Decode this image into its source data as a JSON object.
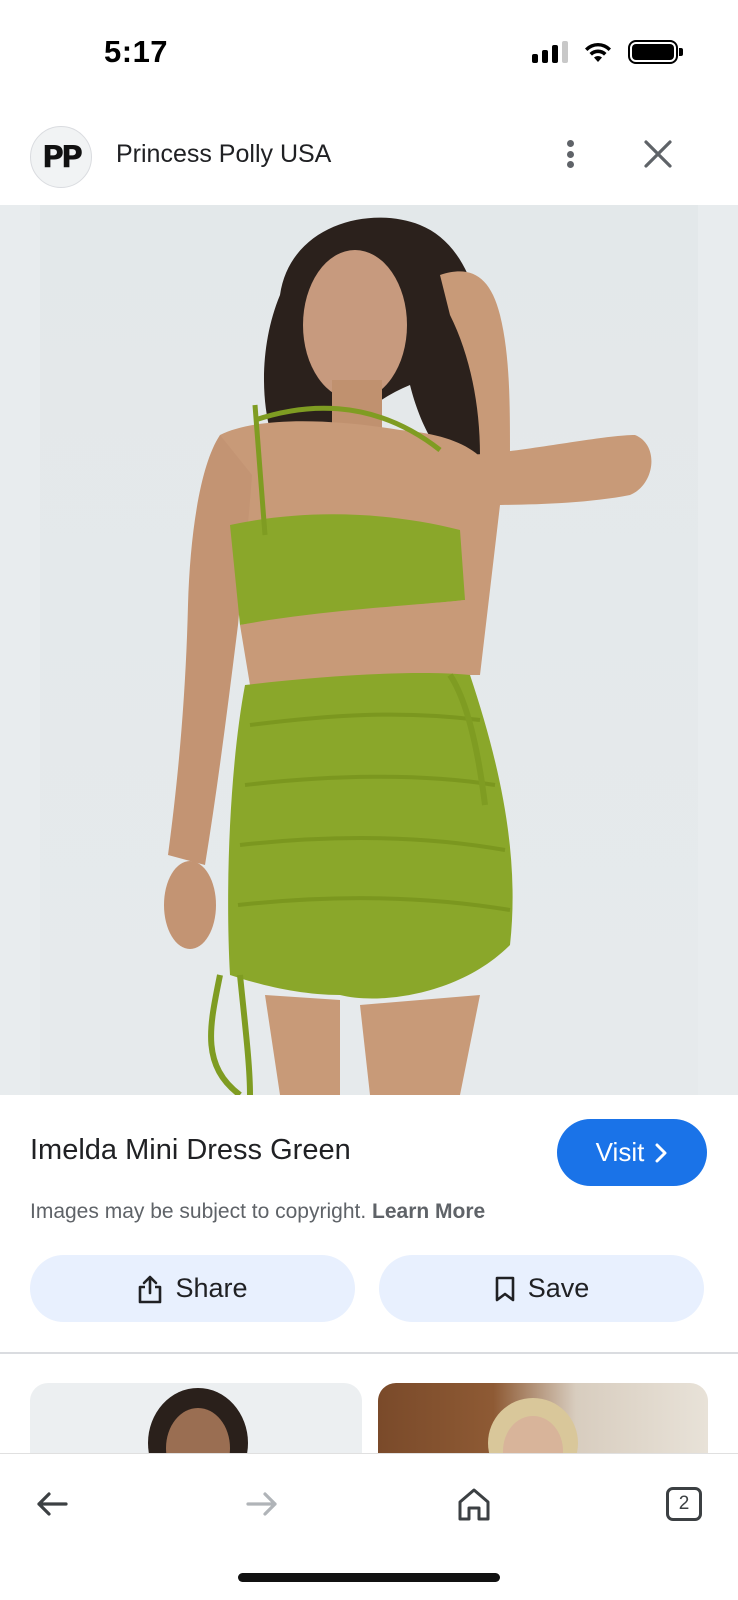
{
  "status_bar": {
    "time": "5:17",
    "signal_icon": "signal-icon",
    "wifi_icon": "wifi-icon",
    "battery_icon": "battery-icon"
  },
  "header": {
    "logo_text": "PP",
    "site_name": "Princess Polly USA",
    "more_icon": "more-vert-icon",
    "close_icon": "close-icon"
  },
  "hero": {
    "image_alt": "Model wearing green one-shoulder cut-out ruched mini dress"
  },
  "product": {
    "title": "Imelda Mini Dress Green",
    "visit_label": "Visit",
    "copyright_text": "Images may be subject to copyright.",
    "learn_more_label": "Learn More"
  },
  "actions": {
    "share_label": "Share",
    "save_label": "Save"
  },
  "bottom_nav": {
    "tab_count": "2"
  },
  "colors": {
    "accent": "#1a73e8",
    "chip_bg": "#e8f0fe",
    "dress_green": "#8aa72a"
  }
}
